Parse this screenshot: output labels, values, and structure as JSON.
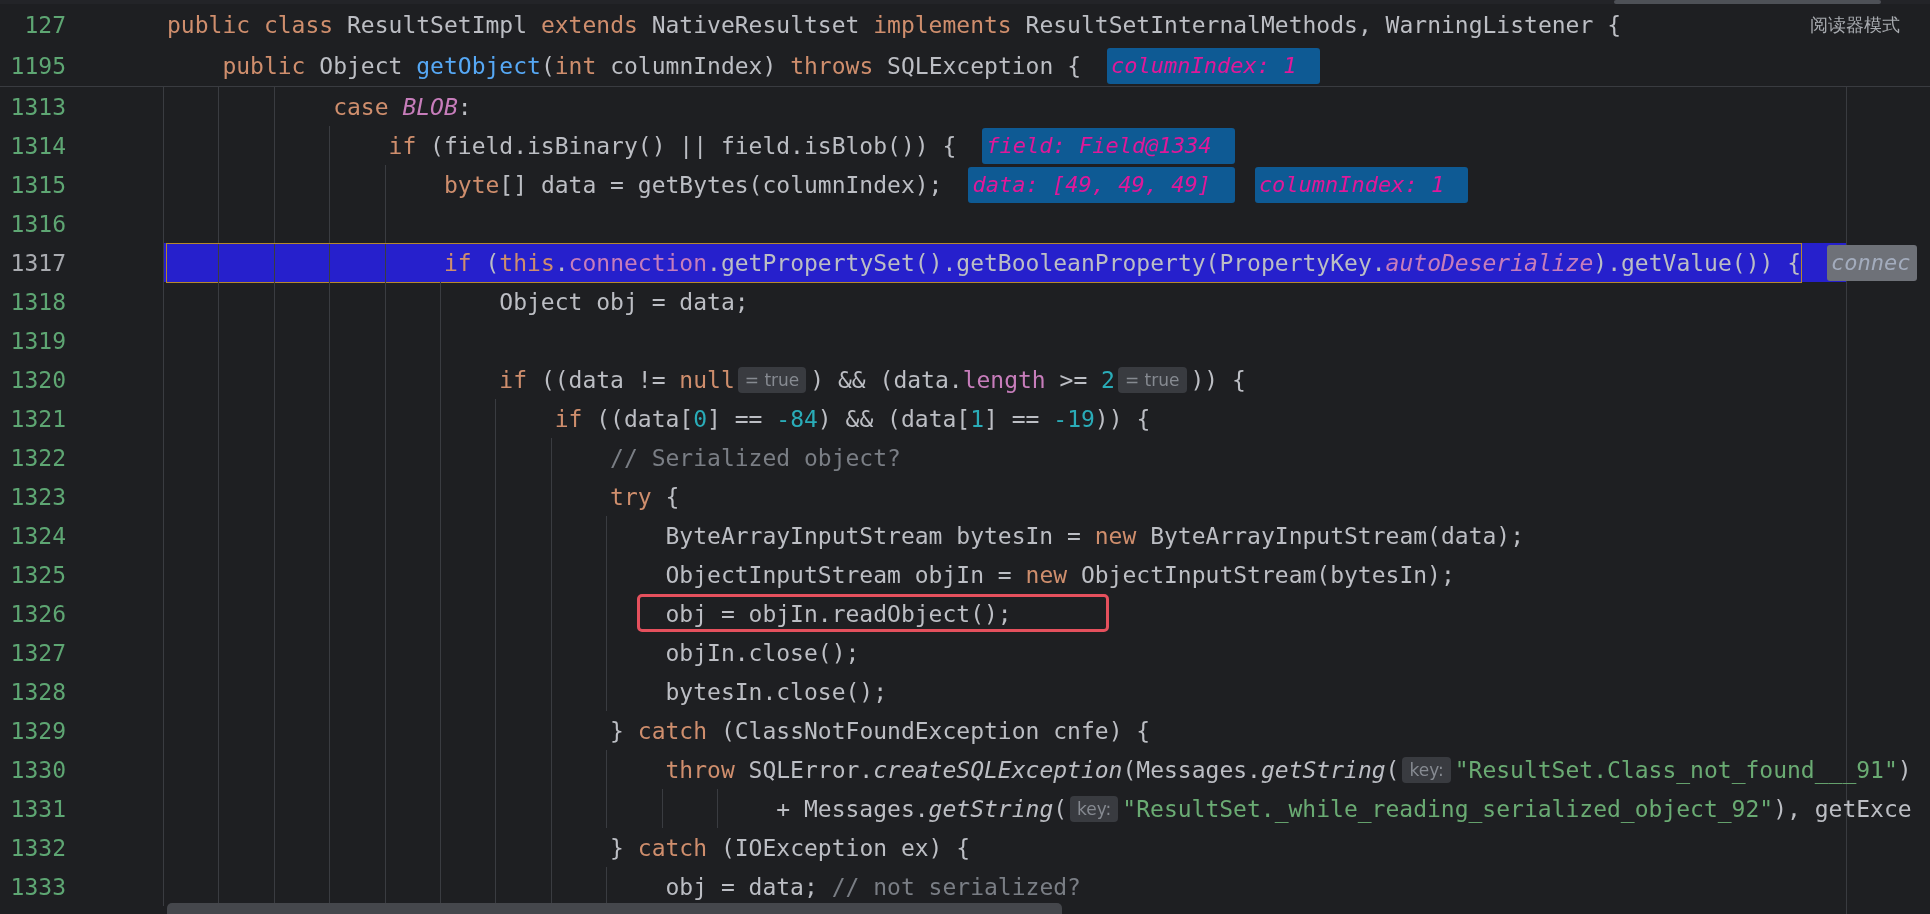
{
  "reader_mode_label": "阅读器模式",
  "sticky_lines": [
    {
      "number": "127",
      "segments": [
        {
          "kind": "keyword",
          "text": "public class"
        },
        {
          "kind": "plain",
          "text": " ResultSetImpl "
        },
        {
          "kind": "keyword",
          "text": "extends"
        },
        {
          "kind": "plain",
          "text": " NativeResultset "
        },
        {
          "kind": "keyword",
          "text": "implements"
        },
        {
          "kind": "plain",
          "text": " ResultSetInternalMethods, WarningListener {"
        }
      ]
    },
    {
      "number": "1195",
      "segments": [
        {
          "kind": "keyword",
          "text": "    public"
        },
        {
          "kind": "plain",
          "text": " Object "
        },
        {
          "kind": "method",
          "text": "getObject"
        },
        {
          "kind": "plain",
          "text": "("
        },
        {
          "kind": "keyword",
          "text": "int"
        },
        {
          "kind": "plain",
          "text": " columnIndex) "
        },
        {
          "kind": "keyword",
          "text": "throws"
        },
        {
          "kind": "plain",
          "text": " SQLException {"
        },
        {
          "kind": "debug-value",
          "text": "columnIndex: 1"
        }
      ]
    }
  ],
  "lines": [
    {
      "number": "1313",
      "highlighted": false,
      "outlined": false,
      "segments": [
        {
          "kind": "keyword",
          "text": "            case "
        },
        {
          "kind": "static",
          "text": "BLOB"
        },
        {
          "kind": "plain",
          "text": ":"
        }
      ]
    },
    {
      "number": "1314",
      "highlighted": false,
      "outlined": false,
      "segments": [
        {
          "kind": "keyword",
          "text": "                if"
        },
        {
          "kind": "plain",
          "text": " (field.isBinary() || field.isBlob()) {"
        },
        {
          "kind": "debug-value",
          "text": "field: Field@1334"
        }
      ]
    },
    {
      "number": "1315",
      "highlighted": false,
      "outlined": false,
      "segments": [
        {
          "kind": "keyword",
          "text": "                    byte"
        },
        {
          "kind": "plain",
          "text": "[] data = getBytes(columnIndex);"
        },
        {
          "kind": "debug-value",
          "text": "data: [49, 49, 49]"
        },
        {
          "kind": "debug-value",
          "text": "columnIndex: 1"
        }
      ]
    },
    {
      "number": "1316",
      "highlighted": false,
      "outlined": false
    },
    {
      "number": "1317",
      "highlighted": true,
      "outlined": false,
      "segments": [
        {
          "kind": "keyword",
          "text": "                    if"
        },
        {
          "kind": "plain",
          "text": " ("
        },
        {
          "kind": "keyword",
          "text": "this"
        },
        {
          "kind": "plain",
          "text": "."
        },
        {
          "kind": "field",
          "text": "connection"
        },
        {
          "kind": "plain",
          "text": ".getPropertySet().getBooleanProperty(PropertyKey."
        },
        {
          "kind": "static",
          "text": "autoDeserialize"
        },
        {
          "kind": "plain",
          "text": ").getValue()) {"
        },
        {
          "kind": "debug-value",
          "text": "connec"
        }
      ]
    },
    {
      "number": "1318",
      "highlighted": false,
      "outlined": false,
      "segments": [
        {
          "kind": "plain",
          "text": "                        Object obj = data;"
        }
      ]
    },
    {
      "number": "1319",
      "highlighted": false,
      "outlined": false
    },
    {
      "number": "1320",
      "highlighted": false,
      "outlined": false,
      "segments": [
        {
          "kind": "keyword",
          "text": "                        if"
        },
        {
          "kind": "plain",
          "text": " ((data != "
        },
        {
          "kind": "keyword",
          "text": "null"
        },
        {
          "kind": "inline-value",
          "text": "= true"
        },
        {
          "kind": "plain",
          "text": ") && (data."
        },
        {
          "kind": "field",
          "text": "length"
        },
        {
          "kind": "plain",
          "text": " >= "
        },
        {
          "kind": "number",
          "text": "2"
        },
        {
          "kind": "inline-value",
          "text": "= true"
        },
        {
          "kind": "plain",
          "text": ")) {"
        }
      ]
    },
    {
      "number": "1321",
      "highlighted": false,
      "outlined": false,
      "segments": [
        {
          "kind": "keyword",
          "text": "                            if"
        },
        {
          "kind": "plain",
          "text": " ((data["
        },
        {
          "kind": "number",
          "text": "0"
        },
        {
          "kind": "plain",
          "text": "] == "
        },
        {
          "kind": "number",
          "text": "-84"
        },
        {
          "kind": "plain",
          "text": ") && (data["
        },
        {
          "kind": "number",
          "text": "1"
        },
        {
          "kind": "plain",
          "text": "] == "
        },
        {
          "kind": "number",
          "text": "-19"
        },
        {
          "kind": "plain",
          "text": ")) {"
        }
      ]
    },
    {
      "number": "1322",
      "highlighted": false,
      "outlined": false,
      "segments": [
        {
          "kind": "comment",
          "text": "                                // Serialized object?"
        }
      ]
    },
    {
      "number": "1323",
      "highlighted": false,
      "outlined": false,
      "segments": [
        {
          "kind": "keyword",
          "text": "                                try"
        },
        {
          "kind": "plain",
          "text": " {"
        }
      ]
    },
    {
      "number": "1324",
      "highlighted": false,
      "outlined": false,
      "segments": [
        {
          "kind": "plain",
          "text": "                                    ByteArrayInputStream bytesIn = "
        },
        {
          "kind": "keyword",
          "text": "new"
        },
        {
          "kind": "plain",
          "text": " ByteArrayInputStream(data);"
        }
      ]
    },
    {
      "number": "1325",
      "highlighted": false,
      "outlined": false,
      "segments": [
        {
          "kind": "plain",
          "text": "                                    ObjectInputStream objIn = "
        },
        {
          "kind": "keyword",
          "text": "new"
        },
        {
          "kind": "plain",
          "text": " ObjectInputStream(bytesIn);"
        }
      ]
    },
    {
      "number": "1326",
      "highlighted": false,
      "outlined": true,
      "segments": [
        {
          "kind": "plain",
          "text": "                                    obj = objIn.readObject();"
        }
      ]
    },
    {
      "number": "1327",
      "highlighted": false,
      "outlined": false,
      "segments": [
        {
          "kind": "plain",
          "text": "                                    objIn.close();"
        }
      ]
    },
    {
      "number": "1328",
      "highlighted": false,
      "outlined": false,
      "segments": [
        {
          "kind": "plain",
          "text": "                                    bytesIn.close();"
        }
      ]
    },
    {
      "number": "1329",
      "highlighted": false,
      "outlined": false,
      "segments": [
        {
          "kind": "plain",
          "text": "                                } "
        },
        {
          "kind": "keyword",
          "text": "catch"
        },
        {
          "kind": "plain",
          "text": " (ClassNotFoundException cnfe) {"
        }
      ]
    },
    {
      "number": "1330",
      "highlighted": false,
      "outlined": false,
      "segments": [
        {
          "kind": "keyword",
          "text": "                                    throw"
        },
        {
          "kind": "plain",
          "text": " SQLError."
        },
        {
          "kind": "italic",
          "text": "createSQLException"
        },
        {
          "kind": "plain",
          "text": "(Messages."
        },
        {
          "kind": "italic",
          "text": "getString"
        },
        {
          "kind": "plain",
          "text": "("
        },
        {
          "kind": "param-hint",
          "text": "key:"
        },
        {
          "kind": "string",
          "text": "\"ResultSet.Class_not_found___91\""
        },
        {
          "kind": "plain",
          "text": ")"
        }
      ]
    },
    {
      "number": "1331",
      "highlighted": false,
      "outlined": false,
      "segments": [
        {
          "kind": "plain",
          "text": "                                            + Messages."
        },
        {
          "kind": "italic",
          "text": "getString"
        },
        {
          "kind": "plain",
          "text": "("
        },
        {
          "kind": "param-hint",
          "text": "key:"
        },
        {
          "kind": "string",
          "text": "\"ResultSet._while_reading_serialized_object_92\""
        },
        {
          "kind": "plain",
          "text": "), getExce"
        }
      ]
    },
    {
      "number": "1332",
      "highlighted": false,
      "outlined": false,
      "segments": [
        {
          "kind": "plain",
          "text": "                                } "
        },
        {
          "kind": "keyword",
          "text": "catch"
        },
        {
          "kind": "plain",
          "text": " (IOException ex) {"
        }
      ]
    },
    {
      "number": "1333",
      "highlighted": false,
      "outlined": false,
      "segments": [
        {
          "kind": "plain",
          "text": "                                    obj = data; "
        },
        {
          "kind": "comment",
          "text": "// not serialized?"
        }
      ]
    }
  ]
}
